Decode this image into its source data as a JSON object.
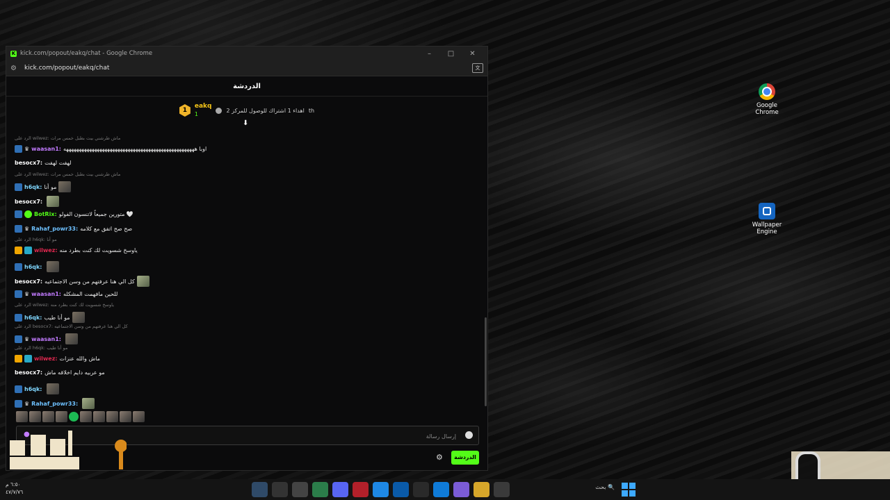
{
  "desktop": {
    "icons": [
      {
        "label": "Google\nChrome",
        "line1": "Google",
        "line2": "Chrome",
        "icon": "chrome-icon"
      },
      {
        "label": "Wallpaper Engine",
        "line1": "Wallpaper",
        "line2": "Engine",
        "icon": "wallpaper-engine-icon"
      }
    ]
  },
  "window": {
    "title": "kick.com/popout/eakq/chat - Google Chrome",
    "url": "kick.com/popout/eakq/chat",
    "controls": [
      "–",
      "□",
      "✕"
    ]
  },
  "chat": {
    "header": "الدردشة",
    "pinned": {
      "rank": "1",
      "username": "eakq",
      "count": "1",
      "text": "اهداء 1 اشتراك للوصول للمركز 2",
      "suffix": "th"
    },
    "messages": [
      {
        "reply": "الرد على wilwez: ماش طرشني بيت بطبل خمس مرات",
        "user": "",
        "text": ""
      },
      {
        "user": "waasan1:",
        "text": "اوبا هههههههههههههههههههههههههههههههههههههههههههههههههههه",
        "color": "pink",
        "badges": [
          "arrow",
          "crown-sym"
        ]
      },
      {
        "user": "besocx7:",
        "text": "لهفت لهفت",
        "color": "white"
      },
      {
        "reply": "الرد على wilwez: ماش طرشني بيت بطبل خمس مرات"
      },
      {
        "user": "h6qk:",
        "text": "مو أنا",
        "color": "cyan",
        "badges": [
          "arrow"
        ],
        "emote": true
      },
      {
        "user": "besocx7:",
        "text": "",
        "color": "white",
        "emote": true
      },
      {
        "user": "BotRix:",
        "text": "متورين جميعاً لاتنسون الفولو 🤍",
        "color": "green",
        "badges": [
          "arrow",
          "check"
        ]
      },
      {
        "user": "Rahaf_powr33:",
        "text": "صح صح اتفق مع كلامه",
        "color": "blue",
        "badges": [
          "arrow",
          "crown-sym"
        ]
      },
      {
        "reply": "الرد على h6qk: مو أنا"
      },
      {
        "user": "wilwez:",
        "text": "ياوسخ شسويت لك كنت بطرد منه",
        "color": "red",
        "badges": [
          "crown",
          "sub"
        ]
      },
      {
        "user": "h6qk:",
        "text": "",
        "color": "cyan",
        "badges": [
          "arrow"
        ],
        "emote": true
      },
      {
        "user": "besocx7:",
        "text": "كل الي هنا عرفتهم من وسن الاجتماعيه",
        "color": "white",
        "emote": true
      },
      {
        "user": "waasan1:",
        "text": "للحين مافهمت المشكله",
        "color": "pink",
        "badges": [
          "arrow",
          "crown-sym"
        ]
      },
      {
        "reply": "الرد على wilwez: ياوسخ شسويت لك كنت بطرد منه"
      },
      {
        "user": "h6qk:",
        "text": "مو أنا طيب",
        "color": "cyan",
        "badges": [
          "arrow"
        ],
        "emote": true
      },
      {
        "reply": "الرد على besocx7: كل الي هنا عرفتهم من وسن الاجتماعيه"
      },
      {
        "user": "waasan1:",
        "text": "",
        "color": "pink",
        "badges": [
          "arrow",
          "crown-sym"
        ],
        "emote": true
      },
      {
        "reply": "الرد على h6qk: مو أنا طيب"
      },
      {
        "user": "wilwez:",
        "text": "ماش والله عنزات",
        "color": "red",
        "badges": [
          "crown",
          "sub"
        ]
      },
      {
        "user": "besocx7:",
        "text": "مو عربيه دايم اخلاقه ماش",
        "color": "white"
      },
      {
        "user": "h6qk:",
        "text": "",
        "color": "cyan",
        "badges": [
          "arrow"
        ],
        "emote": true
      },
      {
        "user": "Rahaf_powr33:",
        "text": "",
        "color": "blue",
        "badges": [
          "arrow",
          "crown-sym"
        ],
        "emote": true
      }
    ],
    "input_placeholder": "إرسال رسالة",
    "send_label": "الدردشة"
  },
  "taskbar": {
    "time": "٦:٥٠ م",
    "date": "٤٧/٧/٧٦",
    "search_placeholder": "بحث"
  }
}
